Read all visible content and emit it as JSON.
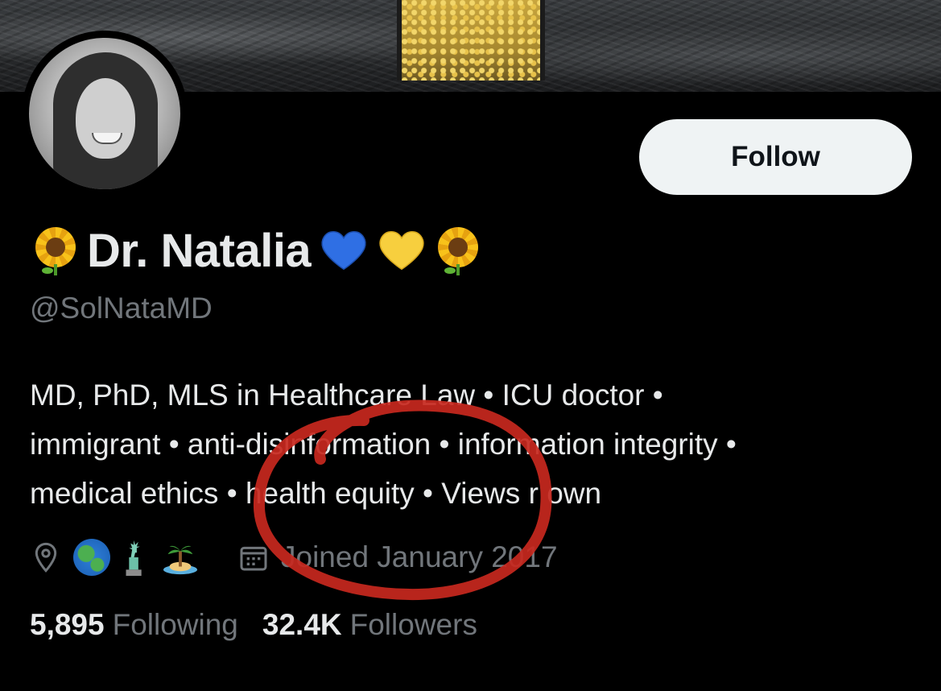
{
  "profile": {
    "display_name": "Dr. Natalia",
    "handle": "@SolNataMD",
    "name_emojis": [
      "sunflower",
      "blue-heart",
      "yellow-heart",
      "sunflower"
    ],
    "bio_lines": [
      "MD, PhD, MLS in Healthcare Law • ICU doctor •",
      "immigrant • anti-disinformation • information integrity •",
      "medical ethics • health equity • Views r own"
    ],
    "location_emojis": [
      "globe-americas",
      "statue-of-liberty",
      "desert-island"
    ],
    "joined": "Joined January 2017"
  },
  "actions": {
    "follow_label": "Follow"
  },
  "stats": {
    "following_count": "5,895",
    "following_label": "Following",
    "followers_count": "32.4K",
    "followers_label": "Followers"
  },
  "colors": {
    "background": "#000000",
    "primary_text": "#e7e9ea",
    "secondary_text": "#71767b",
    "follow_button_bg": "#eff3f4",
    "annotation_circle": "#c8281e"
  }
}
